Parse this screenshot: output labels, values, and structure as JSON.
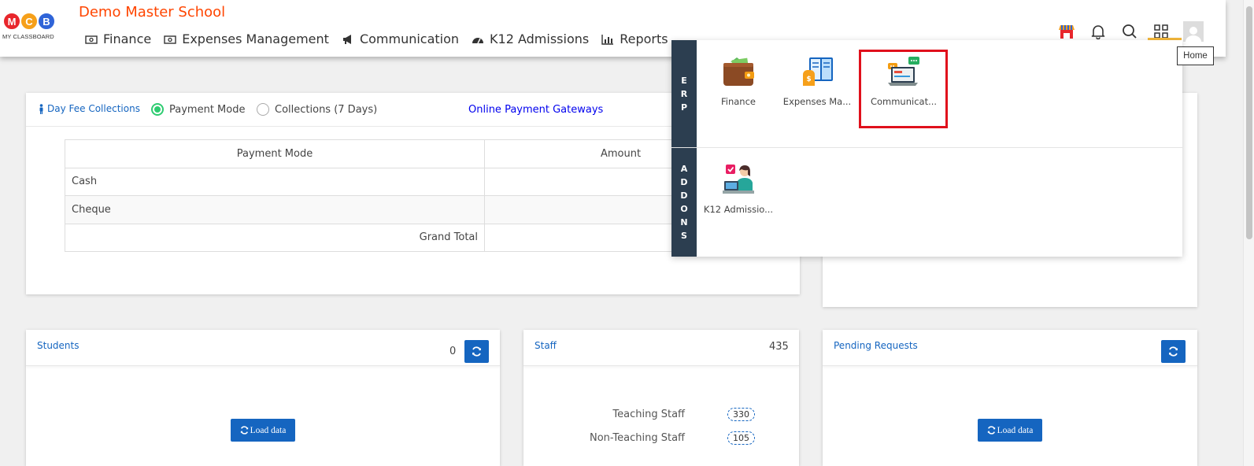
{
  "header": {
    "logo": {
      "letters": [
        "M",
        "C",
        "B"
      ],
      "colors": [
        "#e8262c",
        "#f6a01a",
        "#2f64d8"
      ],
      "subtitle": "MY CLASSBOARD"
    },
    "school_name": "Demo Master School",
    "nav": [
      {
        "label": "Finance",
        "icon": "money-icon"
      },
      {
        "label": "Expenses Management",
        "icon": "money-icon"
      },
      {
        "label": "Communication",
        "icon": "megaphone-icon"
      },
      {
        "label": "K12 Admissions",
        "icon": "dashboard-icon"
      },
      {
        "label": "Reports",
        "icon": "bar-chart-icon"
      }
    ],
    "icons": [
      "store-icon",
      "bell-icon",
      "search-icon",
      "apps-grid-icon",
      "avatar"
    ],
    "tooltip": "Home"
  },
  "fee_card": {
    "title": "Day Fee Collections",
    "radios": [
      {
        "label": "Payment Mode",
        "checked": true
      },
      {
        "label": "Collections (7 Days)",
        "checked": false
      }
    ],
    "gateway_link": "Online Payment Gateways",
    "columns": [
      "Payment Mode",
      "Amount"
    ],
    "rows": [
      {
        "mode": "Cash",
        "amount": ""
      },
      {
        "mode": "Cheque",
        "amount": ""
      }
    ],
    "grand_total_label": "Grand Total",
    "grand_total": ""
  },
  "students_card": {
    "title": "Students",
    "count": "0",
    "load_label": "Load data"
  },
  "staff_card": {
    "title": "Staff",
    "count": "435",
    "rows": [
      {
        "label": "Teaching Staff",
        "value": "330"
      },
      {
        "label": "Non-Teaching Staff",
        "value": "105"
      }
    ]
  },
  "pending_card": {
    "title": "Pending Requests",
    "load_label": "Load data"
  },
  "drawer": {
    "sections": [
      {
        "label": [
          "E",
          "R",
          "P"
        ],
        "apps": [
          "Finance",
          "Expenses Ma...",
          "Communicat..."
        ]
      },
      {
        "label": [
          "A",
          "D",
          "D",
          "O",
          "N",
          "S"
        ],
        "apps": [
          "K12 Admissio..."
        ]
      }
    ],
    "highlight_color": "#e0101c"
  },
  "colors": {
    "accent": "#1565c0",
    "brand": "#ff4500",
    "drawer_label": "#2c3e50",
    "selected_tab": "#f6b93b"
  }
}
